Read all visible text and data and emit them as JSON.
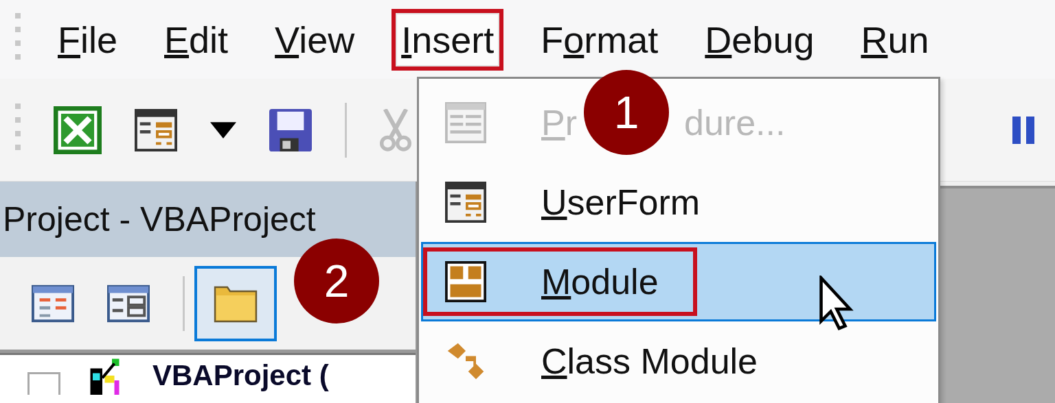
{
  "menu_bar": [
    {
      "label": {
        "key": "F",
        "post": "ile"
      },
      "selected": false,
      "annotated": false
    },
    {
      "label": {
        "key": "E",
        "post": "dit"
      },
      "selected": false,
      "annotated": false
    },
    {
      "label": {
        "key": "V",
        "post": "iew"
      },
      "selected": false,
      "annotated": false
    },
    {
      "label": {
        "key": "I",
        "post": "nsert"
      },
      "selected": true,
      "annotated": true
    },
    {
      "label": {
        "pre": "F",
        "key": "o",
        "post": "rmat"
      },
      "selected": false,
      "annotated": false
    },
    {
      "label": {
        "key": "D",
        "post": "ebug"
      },
      "selected": false,
      "annotated": false
    },
    {
      "label": {
        "key": "R",
        "post": "un"
      },
      "selected": false,
      "annotated": false
    }
  ],
  "project_panel": {
    "title": "Project - VBAProject",
    "toggle_folders": {
      "selected": true
    },
    "tree": [
      {
        "label": "VBAProject ("
      }
    ]
  },
  "insert_menu": {
    "items": [
      {
        "kind": "procedure",
        "label": {
          "key": "P",
          "post": "r",
          "after_cover": "dure..."
        },
        "disabled": true,
        "selected": false,
        "annotated": false
      },
      {
        "kind": "userform",
        "label": {
          "key": "U",
          "post": "serForm"
        },
        "disabled": false,
        "selected": false,
        "annotated": false
      },
      {
        "kind": "module",
        "label": {
          "key": "M",
          "post": "odule"
        },
        "disabled": false,
        "selected": true,
        "annotated": true
      },
      {
        "kind": "class",
        "label": {
          "key": "C",
          "post": "lass Module"
        },
        "disabled": false,
        "selected": false,
        "annotated": false
      }
    ]
  },
  "callouts": [
    {
      "label": "1"
    },
    {
      "label": "2"
    }
  ]
}
